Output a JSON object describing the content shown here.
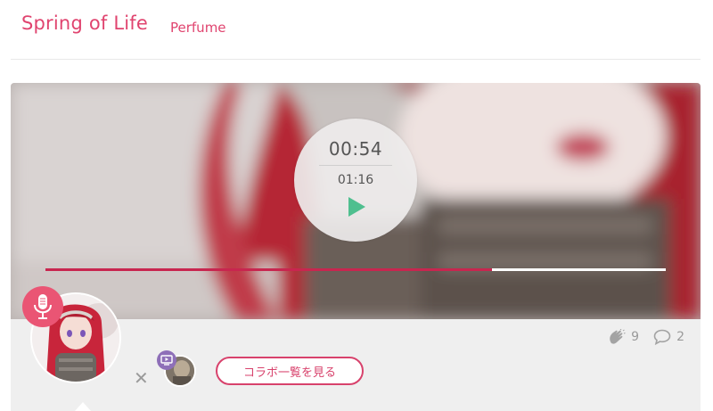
{
  "header": {
    "title": "Spring of Life",
    "artist": "Perfume"
  },
  "player": {
    "current_time": "00:54",
    "total_time": "01:16",
    "progress": 0.72,
    "play_icon": "play-icon"
  },
  "stats": {
    "applause_count": "9",
    "comment_count": "2"
  },
  "collab": {
    "button_label": "コラボ一覧を見る"
  },
  "colors": {
    "accent": "#e0446f",
    "progress_fill": "#c8264f",
    "play": "#4fbf8f",
    "mic_badge": "#ea5574",
    "collab_badge": "#8e6fb8"
  }
}
